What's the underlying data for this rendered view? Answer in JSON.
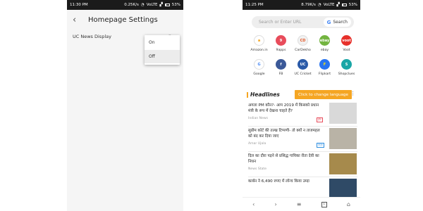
{
  "left": {
    "status": {
      "time": "11:30 PM",
      "speed": "0.25K/s",
      "network": "VoLTE",
      "battery": "53%"
    },
    "header": {
      "back_icon": "back-arrow-icon",
      "title": "Homepage Settings"
    },
    "row": {
      "label": "UC News Display",
      "value": "On"
    },
    "popup": {
      "options": [
        "On",
        "Off"
      ],
      "selected": "Off"
    }
  },
  "right": {
    "status": {
      "time": "11:25 PM",
      "speed": "8.79K/s",
      "network": "VoLTE",
      "battery": "53%"
    },
    "search": {
      "placeholder": "Search or Enter URL",
      "button": "Search",
      "button_icon": "google-icon"
    },
    "tiles": [
      {
        "label": "Amazon.in",
        "icon": "a",
        "color": "#ffffff",
        "fg": "#f29a00"
      },
      {
        "label": "9apps",
        "icon": "9",
        "color": "#e84c5b",
        "fg": "#ffffff"
      },
      {
        "label": "CarDekho",
        "icon": "CD",
        "color": "#f1f1f1",
        "fg": "#e55a2b"
      },
      {
        "label": "ebay",
        "icon": "ebay",
        "color": "#73b440",
        "fg": "#ffffff"
      },
      {
        "label": "Voot",
        "icon": "voot",
        "color": "#e7312b",
        "fg": "#ffffff"
      },
      {
        "label": "Google",
        "icon": "G",
        "color": "#ffffff",
        "fg": "#4285f4"
      },
      {
        "label": "FB",
        "icon": "f",
        "color": "#3b5998",
        "fg": "#ffffff"
      },
      {
        "label": "UC Cricket",
        "icon": "UC",
        "color": "#2a5aa8",
        "fg": "#ffffff"
      },
      {
        "label": "Flipkart",
        "icon": "F",
        "color": "#2874f0",
        "fg": "#ffe500"
      },
      {
        "label": "Shopclues",
        "icon": "S",
        "color": "#1aa6a6",
        "fg": "#ffffff"
      }
    ],
    "headlines": {
      "title": "Headlines",
      "lang_button": "Click to change language",
      "more_icon": "more-vertical-icon"
    },
    "news": [
      {
        "title": "अगला PM कौन?- आप 2019 में किसको प्रधान मंत्री के रूप में देखना चाहते हैं?",
        "source": "Indian News",
        "badge": "हॉट",
        "badge_color": "#e84c5b",
        "thumb_color": "#d9d9d9"
      },
      {
        "title": "सुप्रीम कोर्ट की तल्ख टिप्पणी- तो क्यों न ताजमहल को बंद कर दिया जाए",
        "source": "Amar Ujala",
        "badge": "ताज़ा",
        "badge_color": "#2d8ee0",
        "thumb_color": "#b9b3a6"
      },
      {
        "title": "दिल का दौरा पड़ने से प्रसिद्ध गायिका रीता देवी का निधन",
        "source": "News State",
        "badge": "",
        "badge_color": "#999999",
        "thumb_color": "#a68a4c"
      },
      {
        "title": "कार्बन ने 6,490 रुपए में लॉन्च किया उम्दा",
        "source": "",
        "badge": "",
        "badge_color": "#999999",
        "thumb_color": "#2f4a66"
      }
    ],
    "nav": {
      "back": "back-icon",
      "forward": "forward-icon",
      "menu": "menu-icon",
      "tabs": "tabs-icon",
      "tabs_count": "1",
      "home": "home-icon"
    }
  }
}
